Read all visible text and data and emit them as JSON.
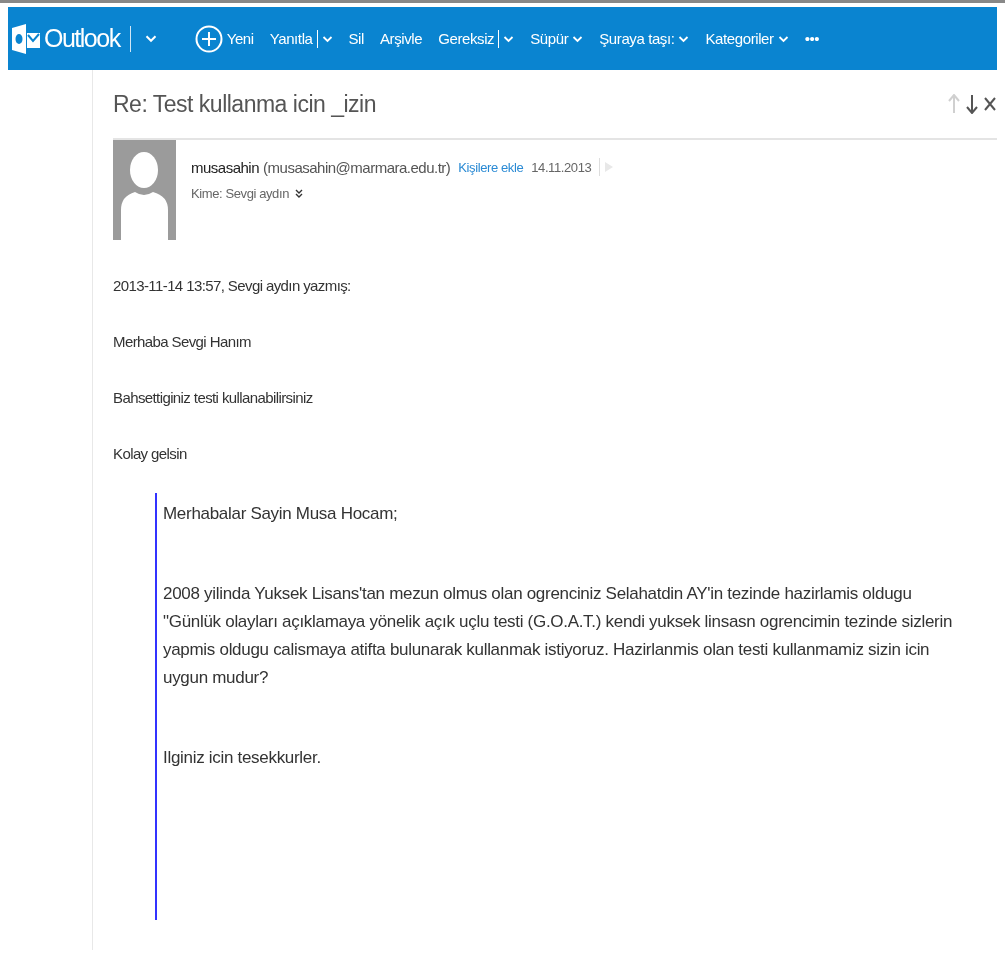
{
  "app": {
    "name": "Outlook"
  },
  "toolbar": [
    {
      "kind": "new",
      "label": "Yeni"
    },
    {
      "kind": "split",
      "label": "Yanıtla"
    },
    {
      "kind": "plain",
      "label": "Sil"
    },
    {
      "kind": "plain",
      "label": "Arşivle"
    },
    {
      "kind": "split",
      "label": "Gereksiz"
    },
    {
      "kind": "menu",
      "label": "Süpür"
    },
    {
      "kind": "menu",
      "label": "Şuraya taşı:"
    },
    {
      "kind": "menu",
      "label": "Kategoriler"
    },
    {
      "kind": "plain",
      "label": "•••"
    }
  ],
  "message": {
    "subject": "Re: Test kullanma icin _izin",
    "previous_disabled": true,
    "sender_name": "musasahin",
    "sender_email": "(musasahin@marmara.edu.tr)",
    "add_contact": "Kişilere ekle",
    "date": "14.11.2013",
    "to": "Kime: Sevgi aydın",
    "body": [
      "2013-11-14 13:57, Sevgi aydın yazmış:",
      "Merhaba Sevgi Hanım",
      "Bahsettiginiz testi kullanabilirsiniz",
      "Kolay gelsin"
    ],
    "quote": [
      "Merhabalar Sayin Musa Hocam;",
      "2008 yilinda Yuksek Lisans'tan mezun olmus olan ogrenciniz Selahatdin AY'in tezinde hazirlamis oldugu \"Günlük olayları açıklamaya yönelik açık uçlu testi (G.O.A.T.) kendi yuksek linsasn ogrencimin tezinde sizlerin yapmis oldugu calismaya atifta bulunarak kullanmak istiyoruz. Hazirlanmis olan testi kullanmamiz sizin icin uygun mudur?",
      "Ilginiz icin tesekkurler."
    ]
  }
}
